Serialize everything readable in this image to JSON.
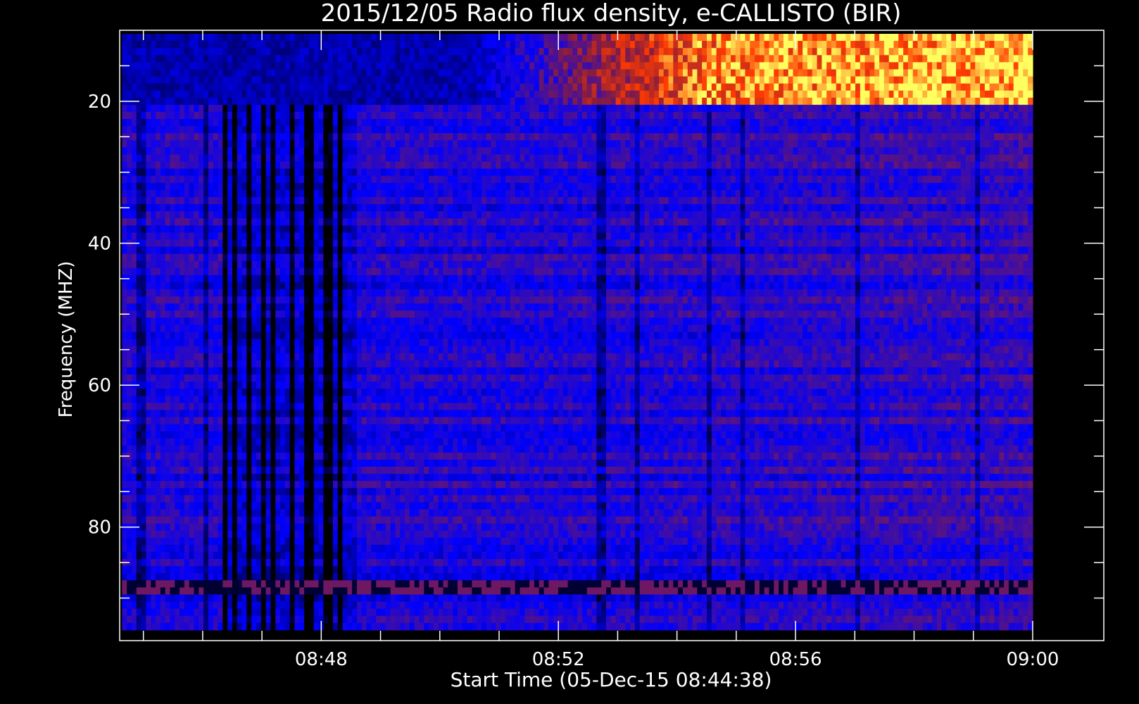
{
  "chart_data": {
    "type": "heatmap",
    "title": "2015/12/05  Radio flux density, e-CALLISTO (BIR)",
    "xlabel": "Start Time (05-Dec-15 08:44:38)",
    "ylabel": "Frequency (MHZ)",
    "x_tick_labels": [
      "08:48",
      "08:52",
      "08:56",
      "09:00"
    ],
    "x_tick_values_min": [
      48,
      52,
      56,
      60
    ],
    "y_tick_labels": [
      "20",
      "40",
      "60",
      "80"
    ],
    "y_tick_values": [
      20,
      40,
      60,
      80
    ],
    "xlim_min": [
      44.6,
      61.2
    ],
    "ylim": [
      96,
      10
    ],
    "data_time_range_min": [
      44.64,
      60.0
    ],
    "data_freq_range_mhz": [
      10.5,
      94.5
    ],
    "grid": false,
    "colormap": [
      "#000000",
      "#0000ff",
      "#8a1e3c",
      "#ff3a00",
      "#ffff60"
    ],
    "background_color": "#000000",
    "features": {
      "bright_emission_band_mhz": [
        10.5,
        21.0
      ],
      "bright_emission_onset_min": 50.5,
      "dark_vertical_striping_min": [
        46.3,
        48.6
      ],
      "interference_row_mhz": 88.5
    }
  }
}
